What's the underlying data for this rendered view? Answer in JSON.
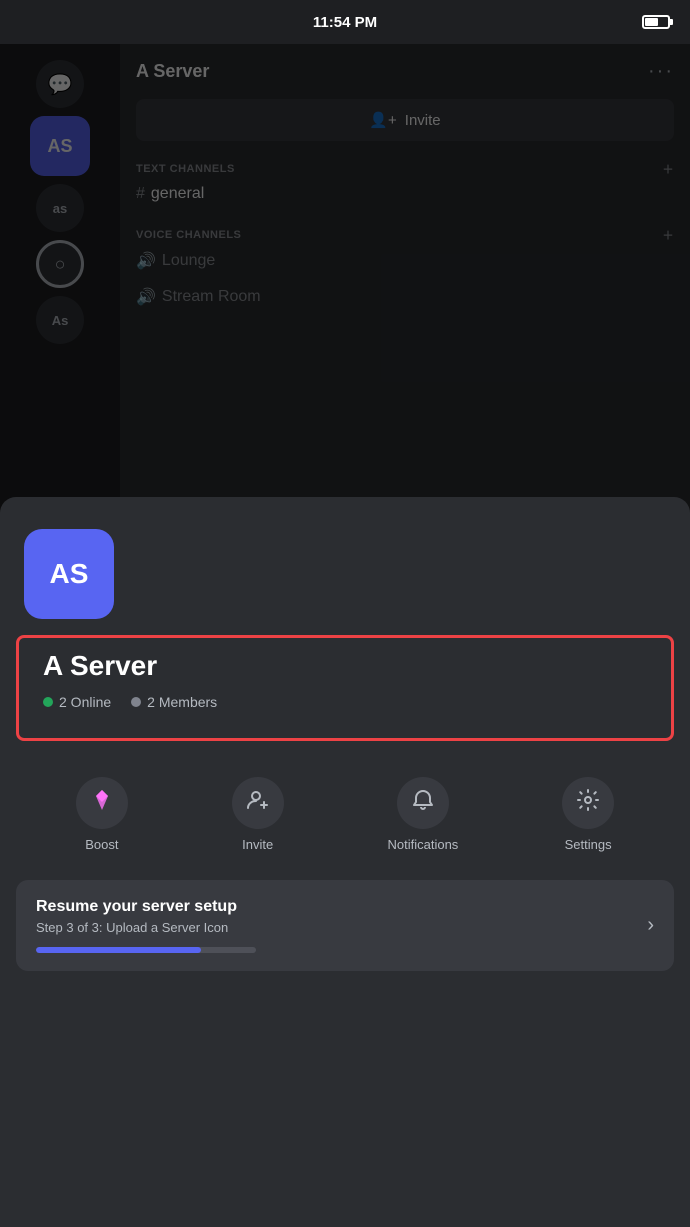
{
  "statusBar": {
    "time": "11:54 PM"
  },
  "background": {
    "serverName": "A Server",
    "inviteLabel": "Invite",
    "textChannelsHeader": "TEXT CHANNELS",
    "voiceChannelsHeader": "VOICE CHANNELS",
    "channels": [
      {
        "type": "text",
        "name": "general"
      },
      {
        "type": "voice",
        "name": "Lounge"
      },
      {
        "type": "voice",
        "name": "Stream Room"
      }
    ]
  },
  "sidebarIcons": [
    {
      "label": "💬",
      "type": "chat"
    },
    {
      "label": "AS",
      "type": "server-active"
    },
    {
      "label": "as",
      "type": "server"
    },
    {
      "label": "○",
      "type": "circle"
    },
    {
      "label": "As",
      "type": "server"
    }
  ],
  "bottomSheet": {
    "serverAvatarLabel": "AS",
    "serverTitle": "A Server",
    "stats": {
      "online": "2 Online",
      "members": "2 Members"
    },
    "actions": [
      {
        "id": "boost",
        "label": "Boost",
        "icon": "boost"
      },
      {
        "id": "invite",
        "label": "Invite",
        "icon": "invite"
      },
      {
        "id": "notifications",
        "label": "Notifications",
        "icon": "bell"
      },
      {
        "id": "settings",
        "label": "Settings",
        "icon": "gear"
      }
    ],
    "resumeCard": {
      "title": "Resume your server setup",
      "subtitle": "Step 3 of 3: Upload a Server Icon",
      "progressPercent": 75
    }
  }
}
